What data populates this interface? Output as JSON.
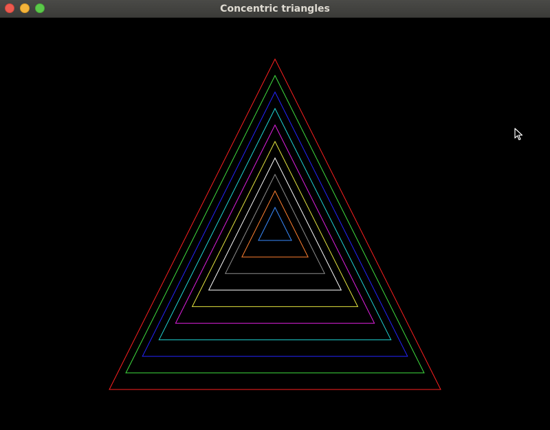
{
  "window": {
    "title": "Concentric triangles",
    "controls": [
      "close",
      "minimize",
      "maximize"
    ]
  },
  "colors": {
    "background": "#000000",
    "triangles": [
      "#ff2020",
      "#40e040",
      "#2424ff",
      "#20d8d8",
      "#e020e0",
      "#e8e840",
      "#ffffff",
      "#909090",
      "#ff8030",
      "#3a8cff"
    ]
  },
  "triangle_count": 10,
  "icons": {
    "cursor": "mouse-pointer-icon"
  }
}
